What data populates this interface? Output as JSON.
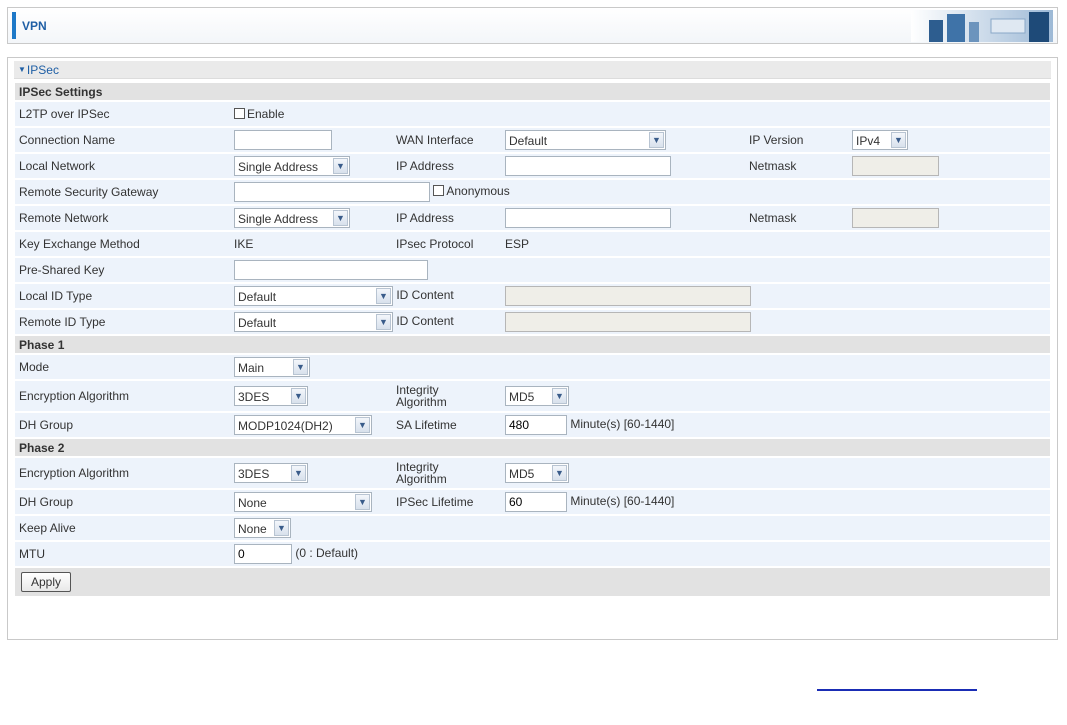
{
  "header": {
    "title": "VPN"
  },
  "section": {
    "title": "IPSec"
  },
  "groups": {
    "settings": "IPSec Settings",
    "phase1": "Phase 1",
    "phase2": "Phase 2"
  },
  "l2tp": {
    "label": "L2TP over IPSec",
    "checkbox_label": "Enable"
  },
  "connection": {
    "name_label": "Connection Name",
    "name_value": "",
    "wan_label": "WAN Interface",
    "wan_value": "Default",
    "ipver_label": "IP Version",
    "ipver_value": "IPv4"
  },
  "local_network": {
    "label": "Local Network",
    "type_value": "Single Address",
    "ip_label": "IP Address",
    "ip_value": "",
    "mask_label": "Netmask",
    "mask_value": ""
  },
  "remote_gateway": {
    "label": "Remote Security Gateway",
    "value": "",
    "anonymous_label": "Anonymous"
  },
  "remote_network": {
    "label": "Remote Network",
    "type_value": "Single Address",
    "ip_label": "IP Address",
    "ip_value": "",
    "mask_label": "Netmask",
    "mask_value": ""
  },
  "key_exchange": {
    "label": "Key Exchange Method",
    "value": "IKE",
    "protocol_label": "IPsec Protocol",
    "protocol_value": "ESP"
  },
  "psk": {
    "label": "Pre-Shared Key",
    "value": ""
  },
  "local_id": {
    "label": "Local ID Type",
    "value": "Default",
    "content_label": "ID Content",
    "content_value": ""
  },
  "remote_id": {
    "label": "Remote ID Type",
    "value": "Default",
    "content_label": "ID Content",
    "content_value": ""
  },
  "phase1": {
    "mode_label": "Mode",
    "mode_value": "Main",
    "enc_label": "Encryption Algorithm",
    "enc_value": "3DES",
    "int_label_1": "Integrity",
    "int_label_2": "Algorithm",
    "int_value": "MD5",
    "dh_label": "DH Group",
    "dh_value": "MODP1024(DH2)",
    "sa_label": "SA Lifetime",
    "sa_value": "480",
    "sa_unit": "Minute(s) [60-1440]"
  },
  "phase2": {
    "enc_label": "Encryption Algorithm",
    "enc_value": "3DES",
    "int_label_1": "Integrity",
    "int_label_2": "Algorithm",
    "int_value": "MD5",
    "dh_label": "DH Group",
    "dh_value": "None",
    "life_label": "IPSec Lifetime",
    "life_value": "60",
    "life_unit": "Minute(s) [60-1440]"
  },
  "keepalive": {
    "label": "Keep Alive",
    "value": "None"
  },
  "mtu": {
    "label": "MTU",
    "value": "0",
    "hint": "(0 : Default)"
  },
  "apply_label": "Apply",
  "colors": {
    "accent": "#1e79c8",
    "title_text": "#1f5fa5",
    "row_bg": "#edf3fb",
    "group_bg": "#e2e2e2"
  }
}
